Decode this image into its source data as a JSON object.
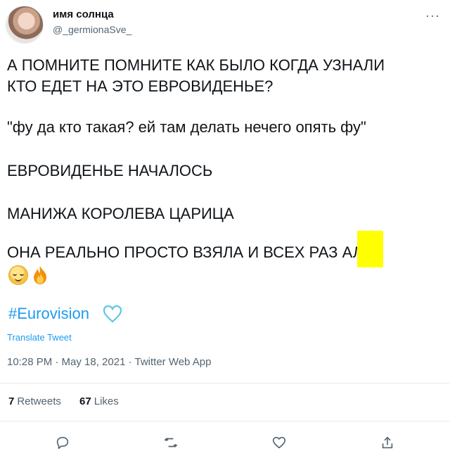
{
  "user": {
    "display_name": "имя солнца",
    "handle": "@_germionaSve_"
  },
  "tweet": {
    "line1": "А ПОМНИТЕ ПОМНИТЕ КАК БЫЛО КОГДА УЗНАЛИ",
    "line2": "КТО ЕДЕТ НА ЭТО ЕВРОВИДЕНЬЕ?",
    "line3": "\"фу да кто такая? ей там делать нечего опять фу\"",
    "line4": "ЕВРОВИДЕНЬЕ НАЧАЛОСЬ",
    "line5": "МАНИЖА КОРОЛЕВА ЦАРИЦА",
    "line6": "ОНА РЕАЛЬНО ПРОСТО ВЗЯЛА И ВСЕХ РАЗ     АЛА",
    "hashtag": "#Eurovision",
    "translate": "Translate Tweet",
    "timestamp": "10:28 PM · May 18, 2021 · Twitter Web App"
  },
  "stats": {
    "retweets_count": "7",
    "retweets_label": "Retweets",
    "likes_count": "67",
    "likes_label": "Likes"
  },
  "icons": {
    "more": "more-icon",
    "reply": "reply-icon",
    "retweet": "retweet-icon",
    "like": "like-icon",
    "share": "share-icon",
    "emoji1": "relieved-face-emoji",
    "emoji2": "fire-emoji",
    "hashtag_icon": "eurovision-heart-icon"
  },
  "colors": {
    "accent": "#1d9bf0",
    "redaction": "#ffff00"
  }
}
